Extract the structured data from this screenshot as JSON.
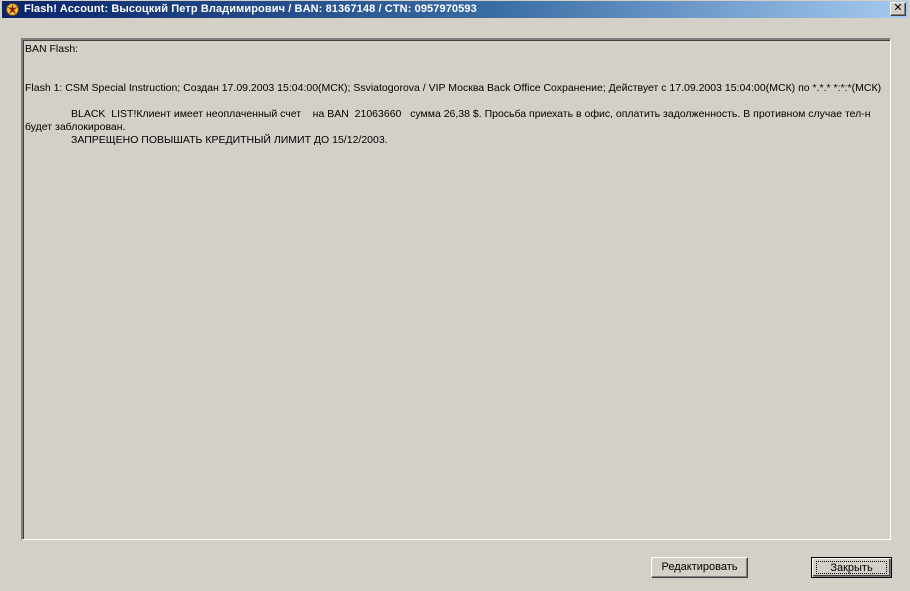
{
  "window": {
    "title": "Flash! Account: Высоцкий Петр Владимирович / BAN: 81367148 / CTN: 0957970593",
    "icon": "flash-app-icon",
    "close_glyph": "✕"
  },
  "content": {
    "header": "BAN Flash:",
    "flash_line": "Flash 1: CSM Special Instruction; Создан 17.09.2003 15:04:00(МСК); Ssviatogorova / VIP Москва Back Office Сохранение; Действует с 17.09.2003 15:04:00(МСК) по *.*.* *:*:*(МСК)",
    "paragraph_1": "BLACK  LIST!Клиент имеет неоплаченный счет    на BAN  21063660   сумма 26,38 $. Просьба приехать в офис, оплатить задолженность. В противном случае тел-н будет заблокирован.",
    "paragraph_2": "ЗАПРЕЩЕНО ПОВЫШАТЬ КРЕДИТНЫЙ ЛИМИТ ДО 15/12/2003."
  },
  "buttons": {
    "edit_label": "Редактировать",
    "close_label": "Закрыть"
  }
}
